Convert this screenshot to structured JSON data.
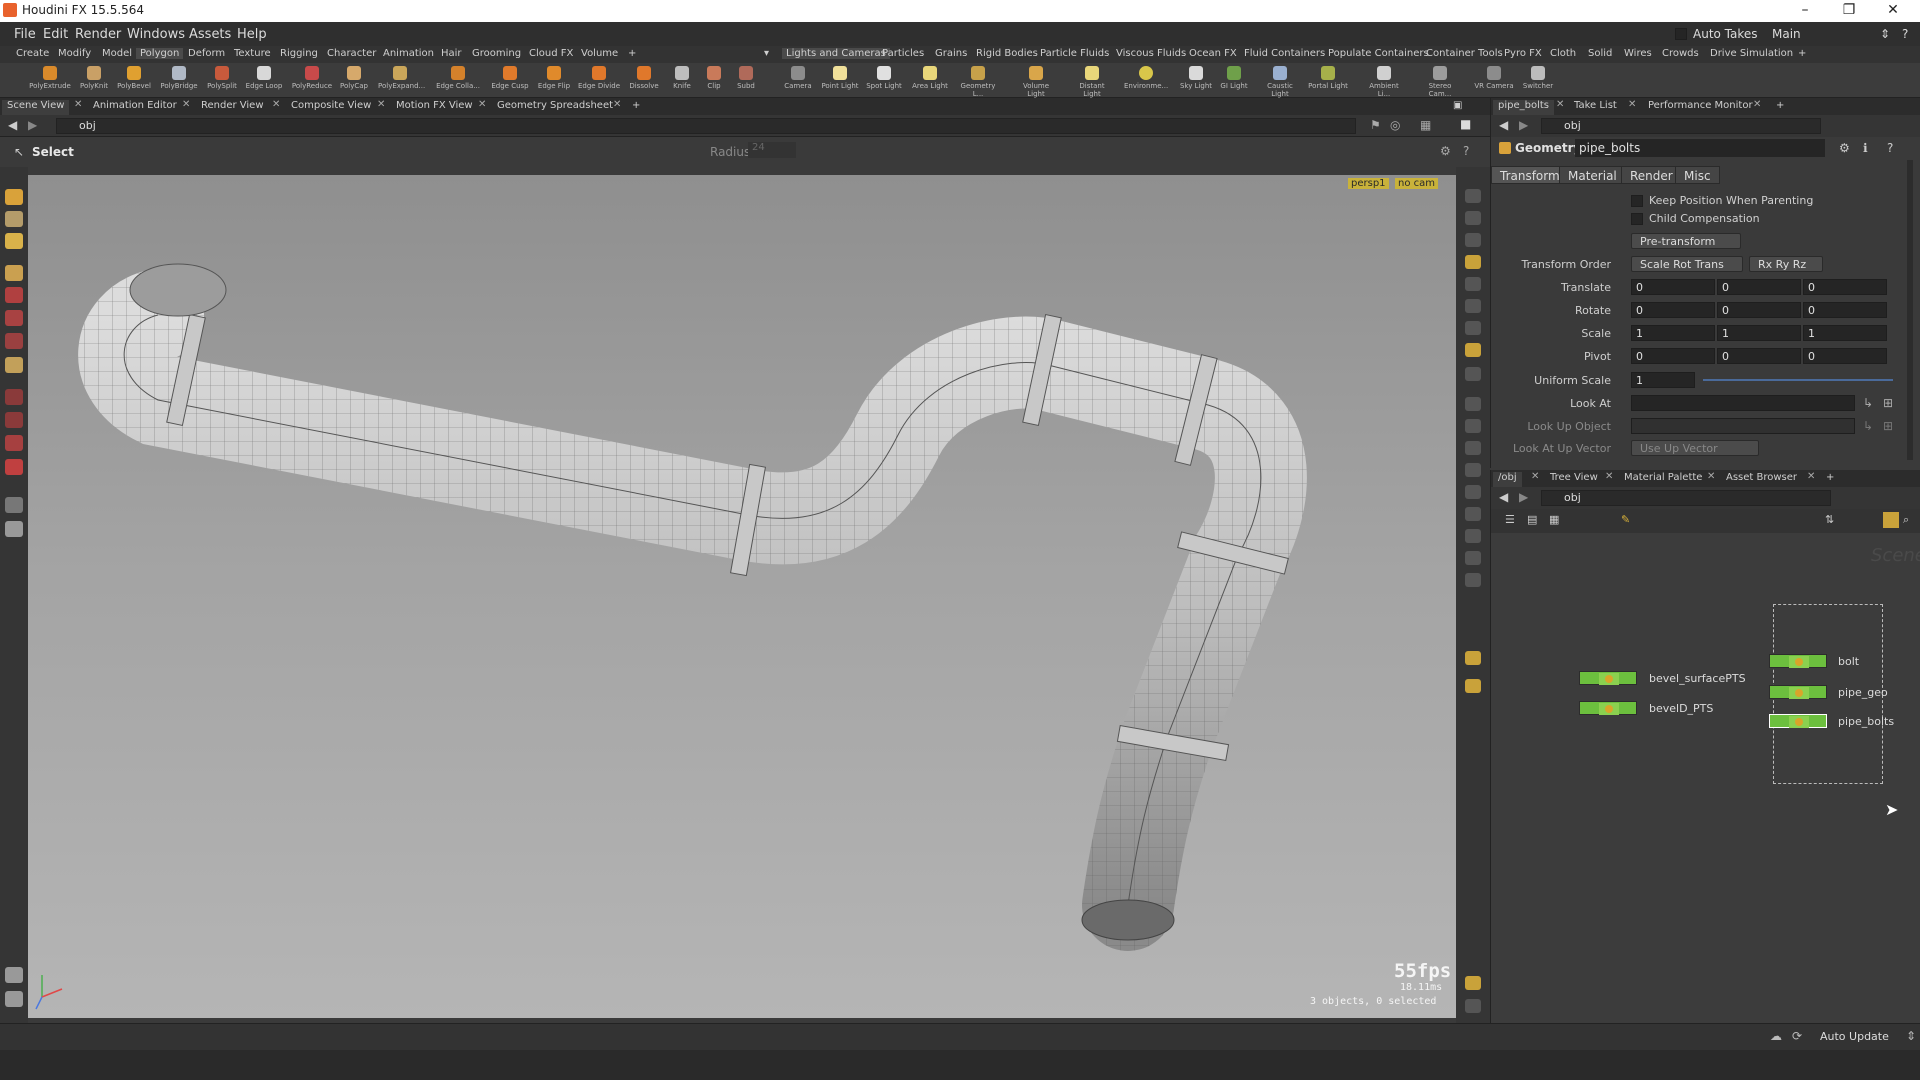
{
  "app": {
    "title": "Houdini FX 15.5.564"
  },
  "window_controls": {
    "minimize": "–",
    "restore": "❐",
    "close": "✕"
  },
  "menu": [
    "File",
    "Edit",
    "Render",
    "Windows",
    "Assets",
    "Help"
  ],
  "auto_takes": "Auto Takes",
  "desktop": "Main",
  "shelf_tabs_left": [
    "Create",
    "Modify",
    "Model",
    "Polygon",
    "Deform",
    "Texture",
    "Rigging",
    "Character",
    "Animation",
    "Hair",
    "Grooming",
    "Cloud FX",
    "Volume"
  ],
  "shelf_tabs_right": [
    "Lights and Cameras",
    "Particles",
    "Grains",
    "Rigid Bodies",
    "Particle Fluids",
    "Viscous Fluids",
    "Ocean FX",
    "Fluid Containers",
    "Populate Containers",
    "Container Tools",
    "Pyro FX",
    "Cloth",
    "Solid",
    "Wires",
    "Crowds",
    "Drive Simulation"
  ],
  "shelf_tools_left": [
    "PolyExtrude",
    "PolyKnit",
    "PolyBevel",
    "PolyBridge",
    "PolySplit",
    "Edge Loop",
    "PolyReduce",
    "PolyCap",
    "PolyExpand...",
    "Edge Colla...",
    "Edge Cusp",
    "Edge Flip",
    "Edge Divide",
    "Dissolve",
    "Knife",
    "Clip",
    "Subd"
  ],
  "shelf_tools_right": [
    "Camera",
    "Point Light",
    "Spot Light",
    "Area Light",
    "Geometry L...",
    "Volume Light",
    "Distant Light",
    "Environme...",
    "Sky Light",
    "GI Light",
    "Caustic Light",
    "Portal Light",
    "Ambient Li...",
    "Stereo Cam...",
    "VR Camera",
    "Switcher"
  ],
  "pane_tabs": [
    "Scene View",
    "Animation Editor",
    "Render View",
    "Composite View",
    "Motion FX View",
    "Geometry Spreadsheet"
  ],
  "path": "obj",
  "op": {
    "label": "Select",
    "radius_label": "Radius",
    "radius_value": "24"
  },
  "viewport": {
    "camera": "persp1",
    "cam_menu": "no cam",
    "fps": "55fps",
    "ms": "18.11ms",
    "selection": "3 objects, 0 selected"
  },
  "params": {
    "tabs": [
      "pipe_bolts",
      "Take List",
      "Performance Monitor"
    ],
    "path": "obj",
    "type": "Geometry",
    "name": "pipe_bolts",
    "sub_tabs": [
      "Transform",
      "Material",
      "Render",
      "Misc"
    ],
    "keep_position": "Keep Position When Parenting",
    "child_comp": "Child Compensation",
    "pre_transform": "Pre-transform",
    "transform_order_label": "Transform Order",
    "transform_order": "Scale Rot Trans",
    "rot_order": "Rx Ry Rz",
    "translate_label": "Translate",
    "translate": [
      "0",
      "0",
      "0"
    ],
    "rotate_label": "Rotate",
    "rotate": [
      "0",
      "0",
      "0"
    ],
    "scale_label": "Scale",
    "scale": [
      "1",
      "1",
      "1"
    ],
    "pivot_label": "Pivot",
    "pivot": [
      "0",
      "0",
      "0"
    ],
    "uniform_scale_label": "Uniform Scale",
    "uniform_scale": "1",
    "look_at_label": "Look At",
    "look_up_object_label": "Look Up Object",
    "look_at_up_vector_label": "Look At Up Vector",
    "look_at_up_vector": "Use Up Vector"
  },
  "network": {
    "tabs": [
      "/obj",
      "Tree View",
      "Material Palette",
      "Asset Browser"
    ],
    "path": "obj",
    "watermark": "Scene",
    "nodes": [
      "bevel_surfacePTS",
      "bevelD_PTS",
      "bolt",
      "pipe_geo",
      "pipe_bolts"
    ]
  },
  "status": {
    "auto_update": "Auto Update"
  }
}
